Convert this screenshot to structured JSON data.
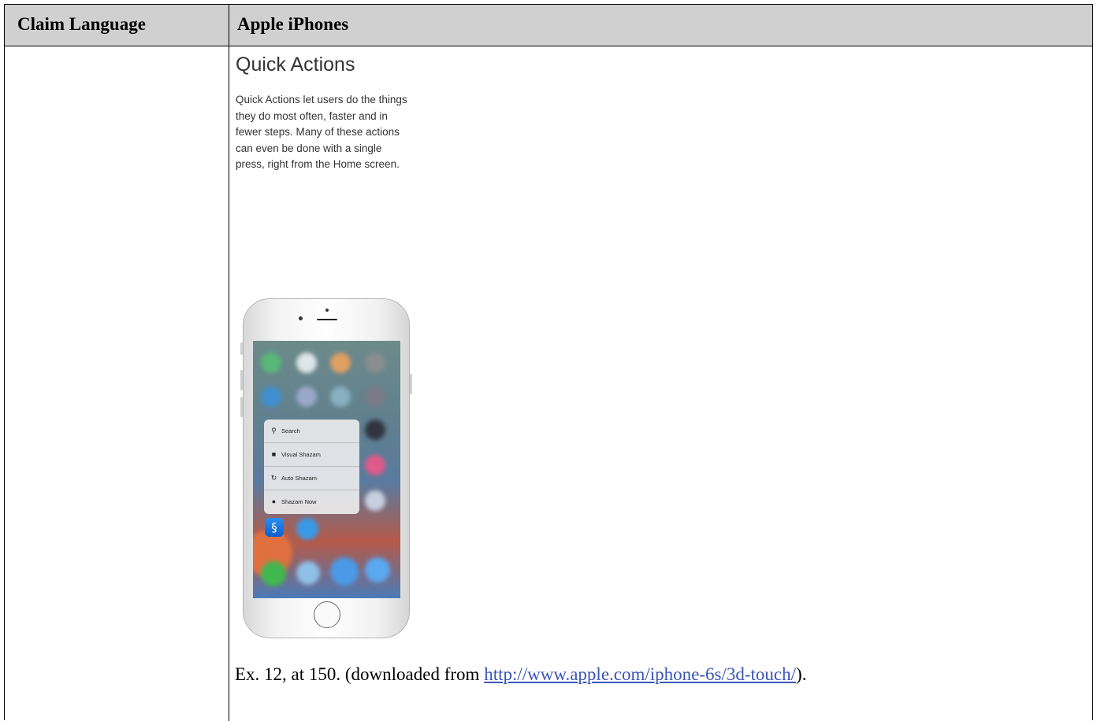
{
  "table": {
    "header": {
      "col1": "Claim Language",
      "col2": "Apple iPhones"
    }
  },
  "quick_actions": {
    "title": "Quick Actions",
    "description": "Quick Actions let users do the things they do most often, faster and in fewer steps. Many of these actions can even be done with a single press, right from the Home screen."
  },
  "phone_menu": {
    "items": [
      {
        "label": "Search",
        "icon": "search-icon"
      },
      {
        "label": "Visual Shazam",
        "icon": "camera-icon"
      },
      {
        "label": "Auto Shazam",
        "icon": "refresh-icon"
      },
      {
        "label": "Shazam Now",
        "icon": "shazam-icon"
      }
    ],
    "app_icon": "shazam-app-icon"
  },
  "caption": {
    "prefix": "Ex. 12, at 150. (downloaded from ",
    "link": "http://www.apple.com/iphone-6s/3d-touch/",
    "suffix": ")."
  }
}
